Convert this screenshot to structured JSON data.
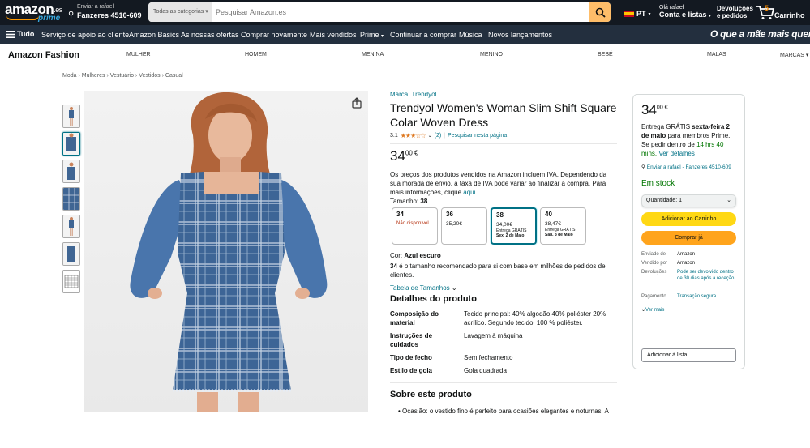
{
  "header": {
    "logo_word": "amazon",
    "logo_tld": ".es",
    "logo_prime": "prime",
    "deliver_line1": "Enviar a rafael",
    "deliver_line2": "Fanzeres 4510-609",
    "search_category": "Todas as categorias",
    "search_placeholder": "Pesquisar Amazon.es",
    "language": "PT",
    "account_line1": "Olá rafael",
    "account_line2": "Conta e listas",
    "orders_line1": "Devoluções",
    "orders_line2": "e pedidos",
    "cart_count": "5",
    "cart_label": "Carrinho"
  },
  "nav": {
    "menu_label": "Tudo",
    "items": [
      "Serviço de apoio ao cliente",
      "Amazon Basics",
      "As nossas ofertas",
      "Comprar novamente",
      "Mais vendidos",
      "Prime",
      "Continuar a comprar",
      "Música",
      "Novos lançamentos"
    ],
    "promo": "O que a mãe mais quer"
  },
  "fashion": {
    "brand": "Amazon Fashion",
    "categories": [
      "MULHER",
      "HOMEM",
      "MENINA",
      "MENINO",
      "BEBÉ",
      "MALAS",
      "MARCAS"
    ]
  },
  "breadcrumb": [
    "Moda",
    "Mulheres",
    "Vestuário",
    "Vestidos",
    "Casual"
  ],
  "product": {
    "brand_link": "Marca: Trendyol",
    "title": "Trendyol Women's Woman Slim Shift Square Colar Woven Dress",
    "rating_value": "3.1",
    "rating_count": "(2)",
    "rating_fraction": 0.62,
    "search_page": "Pesquisar nesta página",
    "price_whole": "34",
    "price_fraction": "00 €",
    "vat_text": "Os preços dos produtos vendidos na Amazon incluem IVA. Dependendo da sua morada de envio, a taxa de IVA pode variar ao finalizar a compra. Para mais informações, clique",
    "vat_link": "aqui.",
    "size_label": "Tamanho:",
    "size_selected": "38",
    "sizes": [
      {
        "name": "34",
        "status": "Não disponível."
      },
      {
        "name": "36",
        "price": "35,20€"
      },
      {
        "name": "38",
        "price": "34,00€",
        "delivery1": "Entrega GRÁTIS",
        "delivery2": "Sex. 2 de Maio"
      },
      {
        "name": "40",
        "price": "38,47€",
        "delivery1": "Entrega GRÁTIS",
        "delivery2": "Sáb. 3 de Maio"
      }
    ],
    "color_label": "Cor:",
    "color_value": "Azul escuro",
    "size_rec_bold": "34",
    "size_rec": "é o tamanho recomendado para si com base em milhões de pedidos de clientes.",
    "size_chart": "Tabela de Tamanhos",
    "details_heading": "Detalhes do produto",
    "details": [
      {
        "key": "Composição do material",
        "value": "Tecido principal: 40% algodão 40% poliéster 20% acrílico. Segundo tecido: 100 % poliéster."
      },
      {
        "key": "Instruções de cuidados",
        "value": "Lavagem à máquina"
      },
      {
        "key": "Tipo de fecho",
        "value": "Sem fechamento"
      },
      {
        "key": "Estilo de gola",
        "value": "Gola quadrada"
      }
    ],
    "about_heading": "Sobre este produto",
    "about_bullet": "Ocasião: o vestido fino é perfeito para ocasiões elegantes e noturnas. A"
  },
  "buybox": {
    "price_whole": "34",
    "price_fraction": "00 €",
    "delivery_a": "Entrega GRÁTIS",
    "delivery_b": "sexta-feira 2 de maio",
    "delivery_c": "para membros Prime. Se pedir dentro de",
    "countdown": "14 hrs 40 mins.",
    "details_link": "Ver detalhes",
    "deliver_to": "Enviar a rafael - Fanzeres 4510-609",
    "stock": "Em stock",
    "quantity": "Quantidade:  1",
    "add_to_cart": "Adicionar ao Carrinho",
    "buy_now": "Comprar já",
    "info": [
      {
        "key": "Enviado de",
        "value": "Amazon"
      },
      {
        "key": "Vendido por",
        "value": "Amazon"
      },
      {
        "key": "Devoluções",
        "value": "Pode ser devolvido dentro de 30 dias após a receção"
      },
      {
        "key": "Pagamento",
        "value": "Transação segura"
      }
    ],
    "more": "Ver mais",
    "add_to_list": "Adicionar à lista"
  },
  "colors": {
    "header": "#131921",
    "nav": "#232f3e",
    "cart_button": "#ffd814",
    "buy_button": "#ffa41c",
    "link": "#007185",
    "stock": "#007600",
    "star": "#de7921"
  }
}
